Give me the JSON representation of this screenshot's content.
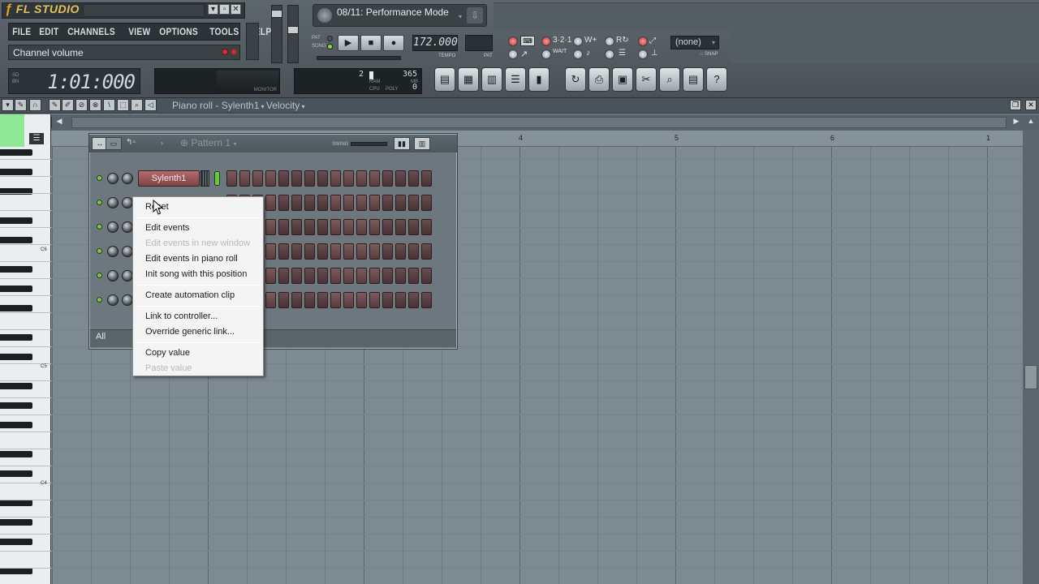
{
  "app": {
    "logo": "FL STUDIO",
    "menu": [
      "FILE",
      "EDIT",
      "CHANNELS",
      "VIEW",
      "OPTIONS",
      "TOOLS",
      "HELP"
    ],
    "hint": "Channel volume",
    "time": "1:01:000",
    "time_small_labels": [
      "SD",
      "BN"
    ],
    "monitor_label": "MONITOR"
  },
  "pattern_selector": {
    "label": "08/11: Performance Mode"
  },
  "transport": {
    "pat_label": "PAT",
    "song_label": "SONG",
    "tempo": "172.000",
    "tempo_label": "TEMPO",
    "pat_small_label": "PAT",
    "snap_value": "(none)",
    "snap_label": "SNAP"
  },
  "cpu": {
    "value_left": "2",
    "value_right": "365",
    "value_bottom": "0",
    "ram_label": "RAM",
    "cpu_label": "CPU",
    "poly_label": "POLY",
    "mb_label": "MB"
  },
  "piano_roll": {
    "title": "Piano roll - Sylenth1",
    "mode": "Velocity",
    "bar_numbers": [
      "4",
      "5",
      "6",
      "1"
    ],
    "octave_labels": [
      "C6",
      "C5",
      "C4"
    ]
  },
  "step_sequencer": {
    "pattern": "Pattern 1",
    "swing_label": "SWING",
    "channel_name": "Sylenth1",
    "filter": "All"
  },
  "context_menu": {
    "items": [
      {
        "label": "Reset",
        "disabled": false
      },
      {
        "label": "Edit events",
        "disabled": false
      },
      {
        "label": "Edit events in new window",
        "disabled": true
      },
      {
        "label": "Edit events in piano roll",
        "disabled": false
      },
      {
        "label": "Init song with this position",
        "disabled": false
      },
      {
        "label": "Create automation clip",
        "disabled": false
      },
      {
        "label": "Link to controller...",
        "disabled": false
      },
      {
        "label": "Override generic link...",
        "disabled": false
      },
      {
        "label": "Copy value",
        "disabled": false
      },
      {
        "label": "Paste value",
        "disabled": true
      }
    ]
  },
  "colors": {
    "accent_green": "#7ec94b",
    "channel_button": "#9a5658",
    "grid_bg": "#7d8a91"
  },
  "icons": [
    "play-icon",
    "stop-icon",
    "record-icon",
    "close-icon",
    "minimize-icon",
    "restore-icon",
    "download-icon",
    "help-icon",
    "arrow-cursor-icon"
  ]
}
